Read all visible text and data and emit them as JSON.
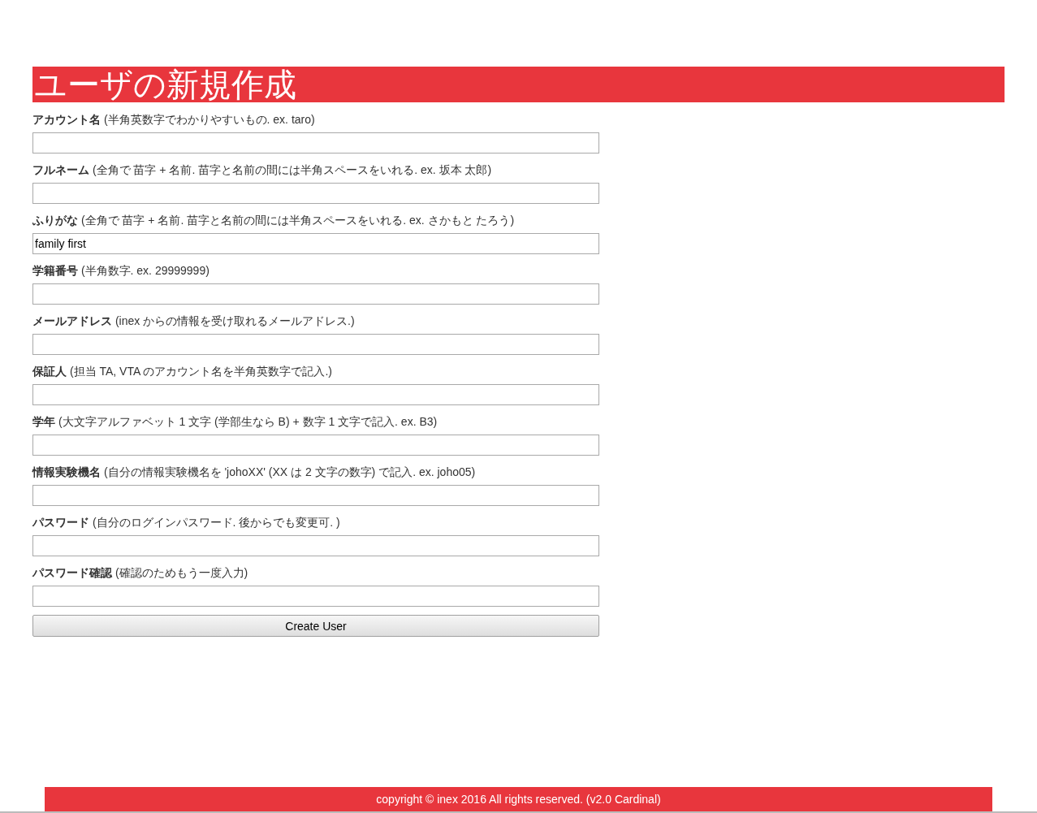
{
  "title": "ユーザの新規作成",
  "fields": [
    {
      "label": "**アカウント名** (半角英数字でわかりやすいもの. ex. taro)"
    },
    {
      "label": "**フルネーム** (全角で 苗字 + 名前. 苗字と名前の間には半角スペースをいれる. ex. 坂本 太郎)"
    },
    {
      "label": "**ふりがな** (全角で 苗字 + 名前. 苗字と名前の間には半角スペースをいれる. ex. さかもと たろう)",
      "value": "family first"
    },
    {
      "label": "**学籍番号** (半角数字. ex. 29999999)"
    },
    {
      "label": "**メールアドレス** (inex からの情報を受け取れるメールアドレス.)"
    },
    {
      "label": "**保証人** (担当 TA, VTA のアカウント名を半角英数字で記入.)"
    },
    {
      "label": "**学年** (大文字アルファベット 1 文字 (学部生なら B) + 数字 1 文字で記入. ex. B3)"
    },
    {
      "label": "**情報実験機名** (自分の情報実験機名を 'johoXX' (XX は 2 文字の数字) で記入. ex. joho05)"
    },
    {
      "label": "**パスワード** (自分のログインパスワード. 後からでも変更可. )"
    },
    {
      "label": "**パスワード確認** (確認のためもう一度入力)"
    }
  ],
  "submit": "Create User",
  "footer": "copyright © inex 2016 All rights reserved. (v2.0 Cardinal)"
}
